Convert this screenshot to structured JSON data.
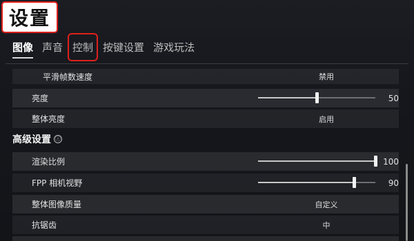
{
  "header": {
    "title": "设置"
  },
  "tabs": [
    {
      "label": "图像",
      "active": true
    },
    {
      "label": "声音"
    },
    {
      "label": "控制",
      "highlighted": true
    },
    {
      "label": "按键设置"
    },
    {
      "label": "游戏玩法"
    }
  ],
  "settings_top": [
    {
      "label": "平滑帧数速度",
      "value": "禁用"
    },
    {
      "label": "亮度",
      "slider_value": 50,
      "slider_max": 100,
      "value": "50"
    },
    {
      "label": "整体亮度",
      "value": "启用"
    }
  ],
  "advanced": {
    "title": "高级设置",
    "info_icon": "ⓘ",
    "rows": [
      {
        "label": "渲染比例",
        "slider_value": 100,
        "slider_max": 100,
        "value": "100"
      },
      {
        "label": "FPP 相机视野",
        "slider_value": 90,
        "slider_max": 110,
        "value": "90"
      },
      {
        "label": "整体图像质量",
        "value": "自定义"
      },
      {
        "label": "抗锯齿",
        "value": "中"
      }
    ]
  },
  "colors": {
    "highlight_border": "#e0201b"
  }
}
